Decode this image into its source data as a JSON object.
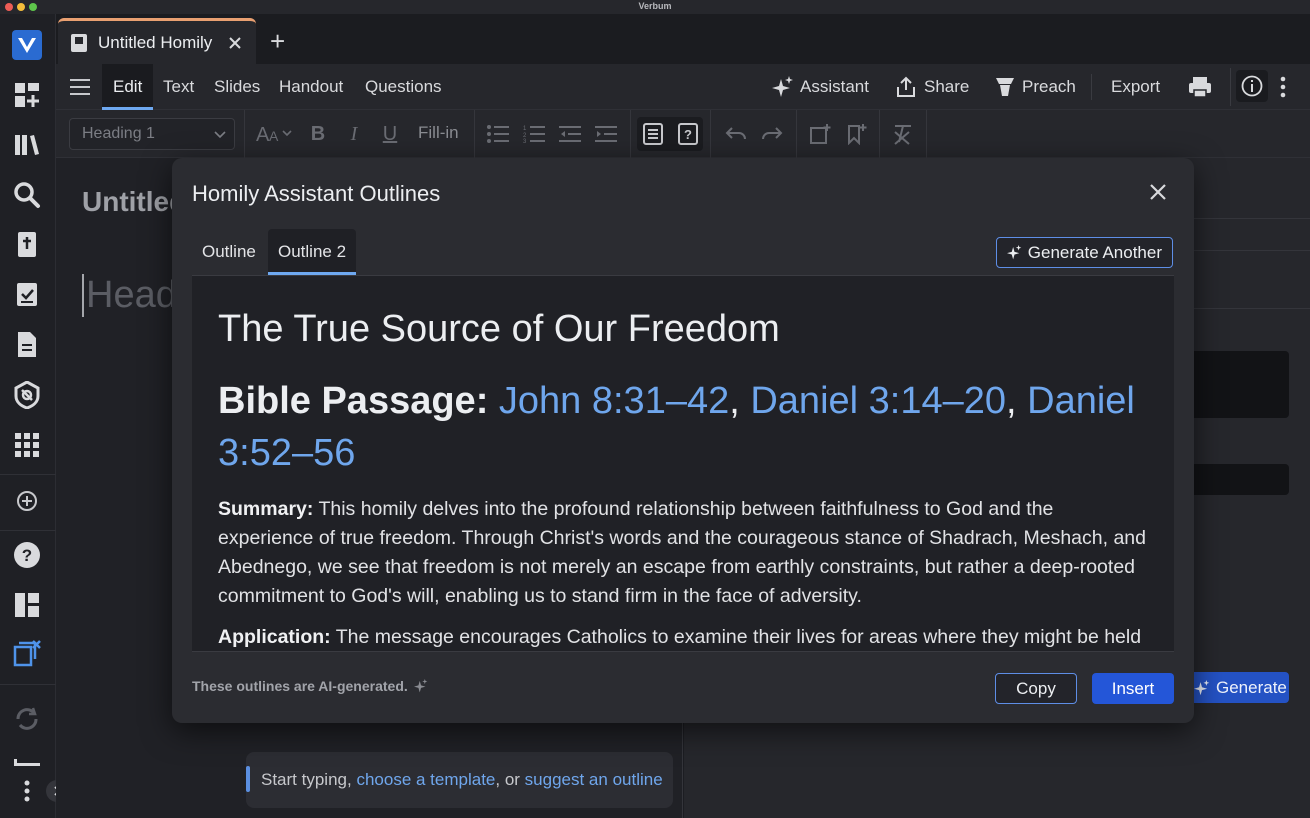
{
  "app": {
    "title": "Verbum"
  },
  "tabs": {
    "doc_tab_label": "Untitled Homily",
    "add_tab_glyph": "+"
  },
  "menubar": {
    "items": [
      "Edit",
      "Text",
      "Slides",
      "Handout",
      "Questions"
    ],
    "right": {
      "assistant": "Assistant",
      "share": "Share",
      "preach": "Preach",
      "export": "Export"
    }
  },
  "toolbar": {
    "style_select_value": "Heading 1",
    "fill_in_label": "Fill-in"
  },
  "editor": {
    "doc_title": "Untitled Homily",
    "heading_placeholder": "Heading 1",
    "start_prefix": "Start typing, ",
    "start_link_template": "choose a template",
    "start_middle": ", or ",
    "start_link_outline": "suggest an outline"
  },
  "modal": {
    "title": "Homily Assistant Outlines",
    "tabs": [
      "Outline",
      "Outline 2"
    ],
    "generate_another": "Generate Another",
    "outline_title": "The True Source of Our Freedom",
    "passage_label": "Bible Passage:",
    "passages": [
      "John 8:31–42",
      "Daniel 3:14–20",
      "Daniel 3:52–56"
    ],
    "summary_label": "Summary:",
    "summary_text": " This homily delves into the profound relationship between faithfulness to God and the experience of true freedom. Through Christ's words and the courageous stance of Shadrach, Meshach, and Abednego, we see that freedom is not merely an escape from earthly constraints, but rather a deep-rooted commitment to God's will, enabling us to stand firm in the face of adversity.",
    "application_label": "Application:",
    "application_text": " The message encourages Catholics to examine their lives for areas where they might be held",
    "ai_note": "These outlines are AI-generated.",
    "copy_label": "Copy",
    "insert_label": "Insert"
  },
  "background": {
    "generate_label": "Generate"
  },
  "colors": {
    "accent": "#6ea8f0",
    "primary_button": "#2456d8",
    "tab_highlight": "#e9a071",
    "link": "#6fa6ec"
  }
}
